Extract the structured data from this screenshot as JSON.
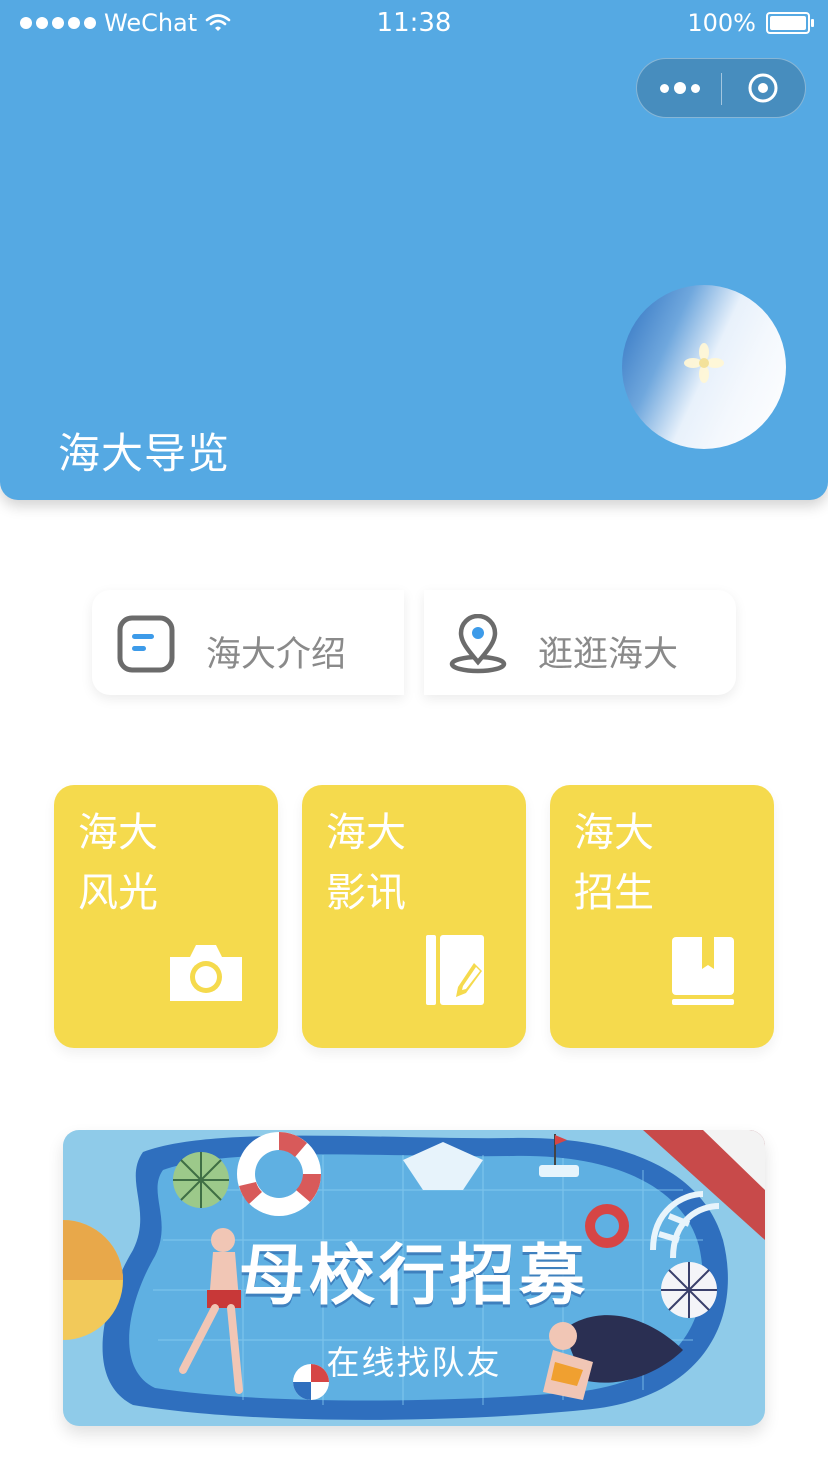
{
  "status_bar": {
    "carrier": "WeChat",
    "time": "11:38",
    "battery": "100%"
  },
  "header": {
    "title": "海大导览",
    "background_color": "#55a9e3"
  },
  "quick_links": [
    {
      "label": "海大介绍",
      "icon": "document-icon"
    },
    {
      "label": "逛逛海大",
      "icon": "location-pin-icon"
    }
  ],
  "cards": [
    {
      "line1": "海大",
      "line2": "风光",
      "icon": "camera-icon"
    },
    {
      "line1": "海大",
      "line2": "影讯",
      "icon": "notebook-edit-icon"
    },
    {
      "line1": "海大",
      "line2": "招生",
      "icon": "book-icon"
    }
  ],
  "card_color": "#f5da4d",
  "banner": {
    "headline": "母校行招募",
    "subtitle": "在线找队友"
  }
}
